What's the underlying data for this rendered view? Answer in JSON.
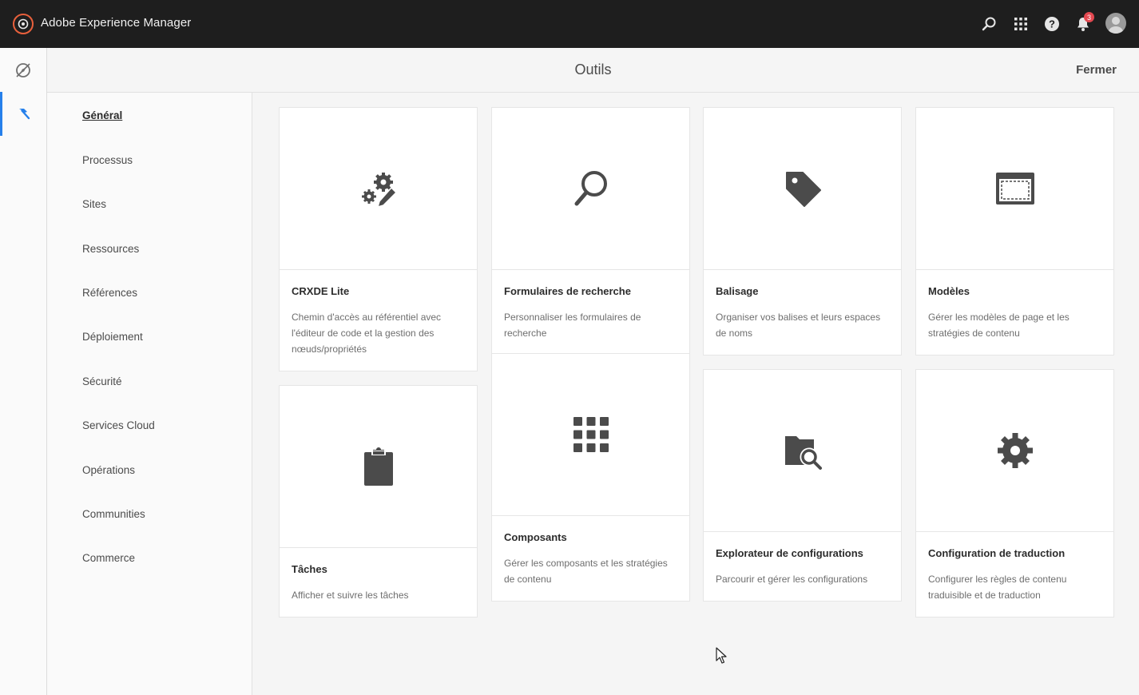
{
  "app": {
    "title": "Adobe Experience Manager"
  },
  "topbar": {
    "icons": [
      "search-icon",
      "apps-grid-icon",
      "help-icon",
      "bell-icon",
      "avatar"
    ],
    "notification_count": "3"
  },
  "rail": {
    "items": [
      "navigation-compass-icon",
      "tools-hammer-icon"
    ],
    "active": "tools-hammer-icon"
  },
  "header": {
    "title": "Outils",
    "close_label": "Fermer"
  },
  "nav": {
    "items": [
      {
        "label": "Général",
        "active": true
      },
      {
        "label": "Processus"
      },
      {
        "label": "Sites"
      },
      {
        "label": "Ressources"
      },
      {
        "label": "Références"
      },
      {
        "label": "Déploiement"
      },
      {
        "label": "Sécurité"
      },
      {
        "label": "Services Cloud"
      },
      {
        "label": "Opérations"
      },
      {
        "label": "Communities"
      },
      {
        "label": "Commerce"
      }
    ]
  },
  "cards": [
    {
      "icon": "gears-pencil-icon",
      "title": "CRXDE Lite",
      "desc": "Chemin d'accès au référentiel avec l'éditeur de code et la gestion des nœuds/propriétés"
    },
    {
      "icon": "magnifier-icon",
      "title": "Formulaires de recherche",
      "desc": "Personnaliser les formulaires de recherche"
    },
    {
      "icon": "tag-icon",
      "title": "Balisage",
      "desc": "Organiser vos balises et leurs espaces de noms"
    },
    {
      "icon": "template-icon",
      "title": "Modèles",
      "desc": "Gérer les modèles de page et les stratégies de contenu"
    },
    {
      "icon": "clipboard-icon",
      "title": "Tâches",
      "desc": "Afficher et suivre les tâches"
    },
    {
      "icon": "components-grid-icon",
      "title": "Composants",
      "desc": "Gérer les composants et les stratégies de contenu"
    },
    {
      "icon": "folder-search-icon",
      "title": "Explorateur de configurations",
      "desc": "Parcourir et gérer les configurations"
    },
    {
      "icon": "gear-icon",
      "title": "Configuration de traduction",
      "desc": "Configurer les règles de contenu traduisible et de traduction"
    }
  ],
  "colors": {
    "topbar": "#1e1e1e",
    "accent": "#2680eb",
    "badge": "#e34850",
    "logo": "#e8603c",
    "icon": "#4b4b4b"
  }
}
